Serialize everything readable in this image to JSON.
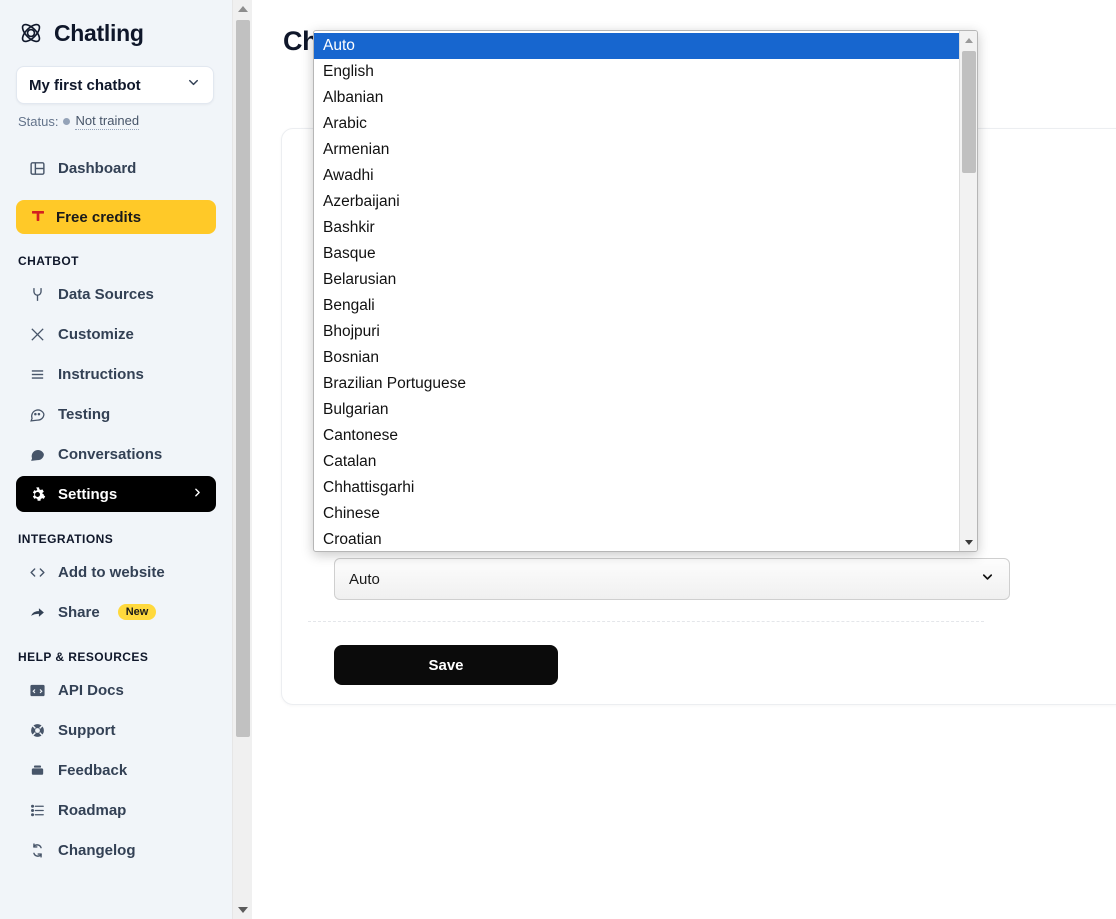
{
  "brand": {
    "name": "Chatling",
    "logo_icon": "atom-icon"
  },
  "sidebar": {
    "chatbot_selector": {
      "value": "My first chatbot",
      "icon": "chevron-down-icon"
    },
    "status": {
      "label": "Status:",
      "value": "Not trained",
      "dot_color": "#94a3b8"
    },
    "dashboard": {
      "label": "Dashboard",
      "icon": "dashboard-icon"
    },
    "credits": {
      "label": "Free credits",
      "icon": "gift-icon",
      "bg_color": "#ffc928"
    },
    "sections": [
      {
        "title": "CHATBOT",
        "items": [
          {
            "label": "Data Sources",
            "icon": "plug-icon",
            "active": false
          },
          {
            "label": "Customize",
            "icon": "sliders-icon",
            "active": false
          },
          {
            "label": "Instructions",
            "icon": "lines-icon",
            "active": false
          },
          {
            "label": "Testing",
            "icon": "chat-dots-icon",
            "active": false
          },
          {
            "label": "Conversations",
            "icon": "chat-bubble-icon",
            "active": false
          },
          {
            "label": "Settings",
            "icon": "gear-icon",
            "active": true,
            "chevron": "chevron-right-icon"
          }
        ]
      },
      {
        "title": "INTEGRATIONS",
        "items": [
          {
            "label": "Add to website",
            "icon": "code-icon",
            "active": false
          },
          {
            "label": "Share",
            "icon": "share-icon",
            "active": false,
            "badge": "New"
          }
        ]
      },
      {
        "title": "HELP & RESOURCES",
        "items": [
          {
            "label": "API Docs",
            "icon": "api-docs-icon",
            "active": false
          },
          {
            "label": "Support",
            "icon": "lifebuoy-icon",
            "active": false
          },
          {
            "label": "Feedback",
            "icon": "inbox-icon",
            "active": false
          },
          {
            "label": "Roadmap",
            "icon": "roadmap-list-icon",
            "active": false
          },
          {
            "label": "Changelog",
            "icon": "refresh-icon",
            "active": false
          }
        ]
      }
    ]
  },
  "main": {
    "page_title": "Chat Settings",
    "language_select": {
      "value": "Auto",
      "icon": "chevron-down-icon"
    },
    "save_button": {
      "label": "Save",
      "bg_color": "#0b0b0b"
    }
  },
  "dropdown": {
    "open": true,
    "selected": "Auto",
    "highlight_color": "#1766cf",
    "options": [
      "Auto",
      "English",
      "Albanian",
      "Arabic",
      "Armenian",
      "Awadhi",
      "Azerbaijani",
      "Bashkir",
      "Basque",
      "Belarusian",
      "Bengali",
      "Bhojpuri",
      "Bosnian",
      "Brazilian Portuguese",
      "Bulgarian",
      "Cantonese",
      "Catalan",
      "Chhattisgarhi",
      "Chinese",
      "Croatian"
    ]
  }
}
